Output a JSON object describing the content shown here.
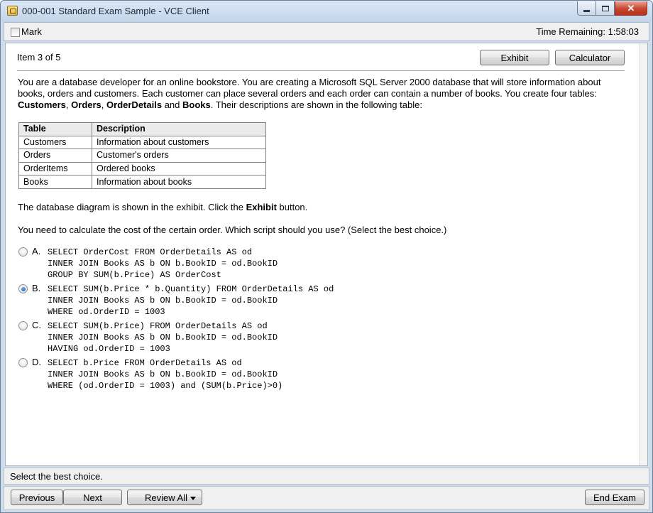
{
  "window": {
    "title": "000-001 Standard Exam Sample - VCE Client"
  },
  "markbar": {
    "mark_label": "Mark",
    "time_remaining": "Time Remaining: 1:58:03"
  },
  "question": {
    "item_label": "Item 3 of 5",
    "exhibit_button": "Exhibit",
    "calculator_button": "Calculator",
    "intro_part1": "You are a database developer for an online bookstore. You are creating a Microsoft SQL Server 2000 database that will store information about books, orders and customers. Each customer can place several orders and each order can contain a number of books. You create four tables: ",
    "tbl_customers": "Customers",
    "sep1": ", ",
    "tbl_orders": "Orders",
    "sep2": ", ",
    "tbl_orderdetails": "OrderDetails",
    "sep3": " and ",
    "tbl_books": "Books",
    "intro_part2": ". Their descriptions are shown in the following table:",
    "table": {
      "headers": [
        "Table",
        "Description"
      ],
      "rows": [
        [
          "Customers",
          "Information about customers"
        ],
        [
          "Orders",
          "Customer's orders"
        ],
        [
          "OrderItems",
          "Ordered books"
        ],
        [
          "Books",
          "Information about books"
        ]
      ]
    },
    "diagram_part1": "The database diagram is shown in the exhibit. Click the ",
    "diagram_bold": "Exhibit",
    "diagram_part2": " button.",
    "prompt": "You need to calculate the cost of the certain order. Which script should you use? (Select the best choice.)",
    "options": [
      {
        "letter": "A.",
        "selected": false,
        "code": "SELECT OrderCost FROM OrderDetails AS od\nINNER JOIN Books AS b ON b.BookID = od.BookID\nGROUP BY SUM(b.Price) AS OrderCost"
      },
      {
        "letter": "B.",
        "selected": true,
        "code": "SELECT SUM(b.Price * b.Quantity) FROM OrderDetails AS od\nINNER JOIN Books AS b ON b.BookID = od.BookID\nWHERE od.OrderID = 1003"
      },
      {
        "letter": "C.",
        "selected": false,
        "code": "SELECT SUM(b.Price) FROM OrderDetails AS od\nINNER JOIN Books AS b ON b.BookID = od.BookID\nHAVING od.OrderID = 1003"
      },
      {
        "letter": "D.",
        "selected": false,
        "code": "SELECT b.Price FROM OrderDetails AS od\nINNER JOIN Books AS b ON b.BookID = od.BookID\nWHERE (od.OrderID = 1003) and (SUM(b.Price)>0)"
      }
    ]
  },
  "status": {
    "text": "Select the best choice."
  },
  "navigation": {
    "previous": "Previous",
    "next": "Next",
    "review_all": "Review All",
    "end_exam": "End Exam"
  },
  "colors": {
    "frame": "#cfdcec",
    "panel": "#f0f0f0",
    "radio_selected": "#0d4e9c"
  }
}
